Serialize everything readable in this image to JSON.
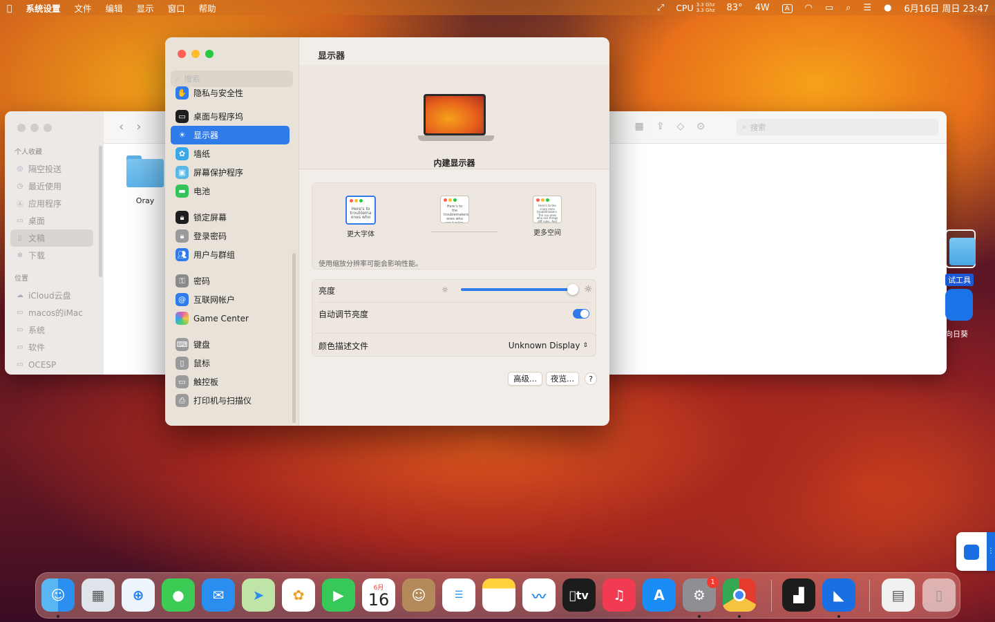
{
  "menubar": {
    "app": "系统设置",
    "menus": [
      "文件",
      "编辑",
      "显示",
      "窗口",
      "帮助"
    ],
    "cpu_label": "CPU",
    "cpu_freq1": "3.3 Ghz",
    "cpu_freq2": "3.3 Ghz",
    "temp": "83°",
    "power": "4W",
    "input_method": "A",
    "datetime": "6月16日 周日 23:47"
  },
  "finder": {
    "sections": {
      "favorites": "个人收藏",
      "locations": "位置"
    },
    "favorites": [
      "隔空投送",
      "最近使用",
      "应用程序",
      "桌面",
      "文稿",
      "下载"
    ],
    "locations": [
      "iCloud云盘",
      "macos的iMac",
      "系统",
      "软件",
      "OCESP"
    ],
    "search_placeholder": "搜索",
    "folder_name": "Oray"
  },
  "desktop": {
    "folder_label": "试工具",
    "app_label": "向日葵"
  },
  "settings": {
    "search_placeholder": "搜索",
    "sidebar": [
      {
        "label": "隐私与安全性",
        "icon": "hand-icon",
        "color": "#2f7bea"
      },
      {
        "label": "桌面与程序坞",
        "icon": "dock-icon",
        "color": "#1e1e1e"
      },
      {
        "label": "显示器",
        "icon": "sun-icon",
        "color": "#2f7bea"
      },
      {
        "label": "墙纸",
        "icon": "flower-icon",
        "color": "#39a8e8"
      },
      {
        "label": "屏幕保护程序",
        "icon": "screensaver-icon",
        "color": "#5bb7e6"
      },
      {
        "label": "电池",
        "icon": "battery-icon",
        "color": "#36c25a"
      },
      {
        "label": "锁定屏幕",
        "icon": "lock-icon",
        "color": "#1e1e1e"
      },
      {
        "label": "登录密码",
        "icon": "lock-icon",
        "color": "#9a9a9a"
      },
      {
        "label": "用户与群组",
        "icon": "users-icon",
        "color": "#2f7bea"
      },
      {
        "label": "密码",
        "icon": "key-icon",
        "color": "#8a8a8a"
      },
      {
        "label": "互联网帐户",
        "icon": "at-icon",
        "color": "#2f7bea"
      },
      {
        "label": "Game Center",
        "icon": "gamecenter-icon",
        "color": "#e05ab0"
      },
      {
        "label": "键盘",
        "icon": "keyboard-icon",
        "color": "#9a9a9a"
      },
      {
        "label": "鼠标",
        "icon": "mouse-icon",
        "color": "#9a9a9a"
      },
      {
        "label": "触控板",
        "icon": "trackpad-icon",
        "color": "#9a9a9a"
      },
      {
        "label": "打印机与扫描仪",
        "icon": "printer-icon",
        "color": "#9a9a9a"
      }
    ],
    "title": "显示器",
    "display_name": "内建显示器",
    "resolution": {
      "options": [
        "更大字体",
        "",
        "更多空间"
      ],
      "selected": 0,
      "note": "使用缩放分辨率可能会影响性能。"
    },
    "brightness_label": "亮度",
    "brightness_value": 0.94,
    "auto_brightness_label": "自动调节亮度",
    "auto_brightness_on": true,
    "color_profile_label": "颜色描述文件",
    "color_profile_value": "Unknown Display",
    "buttons": {
      "advanced": "高级...",
      "night_shift": "夜览...",
      "help": "?"
    }
  },
  "dock": {
    "apps": [
      "Finder",
      "Launchpad",
      "Safari",
      "信息",
      "邮件",
      "地图",
      "照片",
      "FaceTime",
      "日历",
      "通讯录",
      "提醒事项",
      "备忘录",
      "无边记",
      "TV",
      "音乐",
      "App Store",
      "系统设置",
      "Chrome",
      "活动监视器",
      "向日葵",
      "文件",
      "废纸篓"
    ],
    "calendar_month": "6月",
    "calendar_day": "16",
    "tv_label": "tv",
    "settings_badge": "1"
  }
}
